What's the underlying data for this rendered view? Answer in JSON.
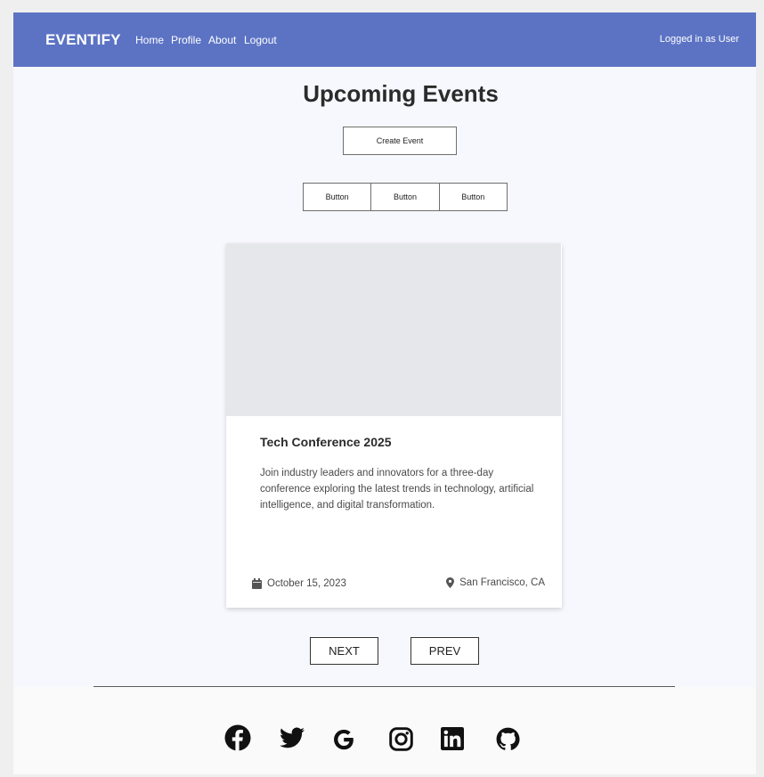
{
  "navbar": {
    "brand": "EVENTIFY",
    "links": [
      "Home",
      "Profile",
      "About",
      "Logout"
    ],
    "user_status": "Logged in as User",
    "color": "#5c73c4"
  },
  "main": {
    "title": "Upcoming Events",
    "create_button": "Create Event",
    "button_group": [
      "Button",
      "Button",
      "Button"
    ]
  },
  "event_card": {
    "title": "Tech Conference 2025",
    "description": "Join industry leaders and innovators for a three-day conference exploring the latest trends in technology, artificial intelligence, and digital transformation.",
    "date": "October 15, 2023",
    "location": "San Francisco, CA",
    "date_icon": "calendar-icon",
    "location_icon": "map-pin-icon"
  },
  "pagination": {
    "next": "NEXT",
    "prev": "PREV"
  },
  "footer": {
    "social_icons": [
      "facebook-icon",
      "twitter-icon",
      "google-icon",
      "instagram-icon",
      "linkedin-icon",
      "github-icon"
    ]
  }
}
